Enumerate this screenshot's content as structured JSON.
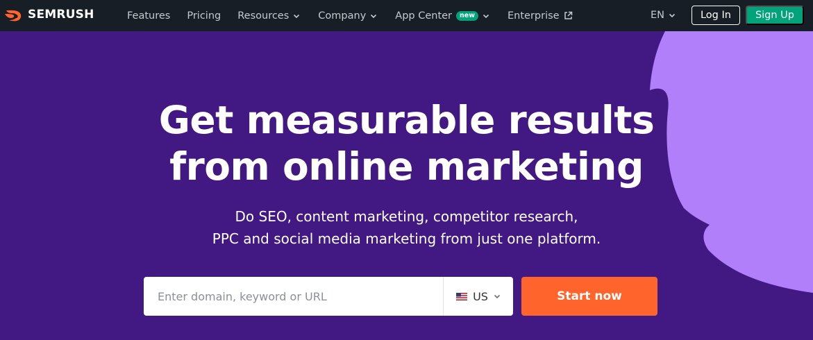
{
  "brand": {
    "name": "SEMRUSH",
    "logo_color": "#ff642d"
  },
  "nav": {
    "items": [
      {
        "label": "Features",
        "dropdown": false
      },
      {
        "label": "Pricing",
        "dropdown": false
      },
      {
        "label": "Resources",
        "dropdown": true
      },
      {
        "label": "Company",
        "dropdown": true
      },
      {
        "label": "App Center",
        "dropdown": true,
        "badge": "new"
      },
      {
        "label": "Enterprise",
        "dropdown": false,
        "icon": "external-link-icon"
      }
    ],
    "language": "EN",
    "login_label": "Log In",
    "signup_label": "Sign Up"
  },
  "hero": {
    "title_line1": "Get measurable results",
    "title_line2": "from online marketing",
    "subtitle_line1": "Do SEO, content marketing, competitor research,",
    "subtitle_line2": "PPC and social media marketing from just one platform.",
    "search": {
      "placeholder": "Enter domain, keyword or URL",
      "value": "",
      "country": "US",
      "country_icon": "us-flag-icon"
    },
    "cta_label": "Start now"
  },
  "colors": {
    "nav_bg": "#181e25",
    "hero_bg": "#421983",
    "hero_shape": "#b17ffa",
    "signup": "#00a37a",
    "cta": "#ff642d"
  }
}
